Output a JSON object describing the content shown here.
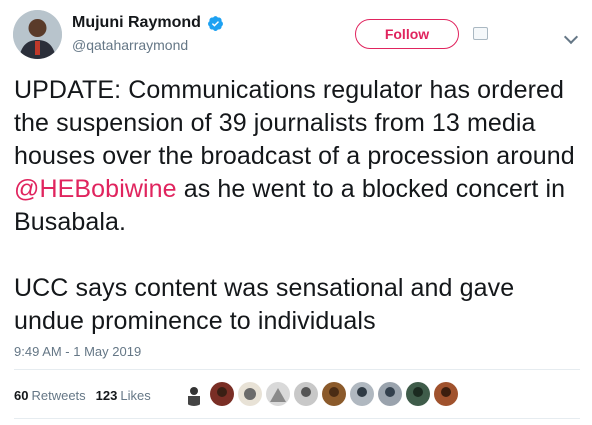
{
  "author": {
    "display_name": "Mujuni Raymond",
    "handle": "@qataharraymond",
    "verified": true,
    "verified_icon": "verified-badge-icon"
  },
  "follow_button": {
    "label": "Follow"
  },
  "tweet": {
    "paragraph1_before": "UPDATE: Communications regulator has ordered the suspension of 39 journalists from 13 media houses over the broadcast of a procession around ",
    "mention": "@HEBobiwine",
    "paragraph1_after": " as he went to a blocked concert in Busabala.",
    "paragraph2": "UCC says content was sensational and gave undue prominence to individuals"
  },
  "timestamp": "9:49 AM - 1 May 2019",
  "stats": {
    "retweets_count": "60",
    "retweets_label": "Retweets",
    "likes_count": "123",
    "likes_label": "Likes"
  },
  "colors": {
    "accent": "#e0245e",
    "verified": "#1da1f2",
    "muted": "#657786",
    "text": "#14171a"
  }
}
